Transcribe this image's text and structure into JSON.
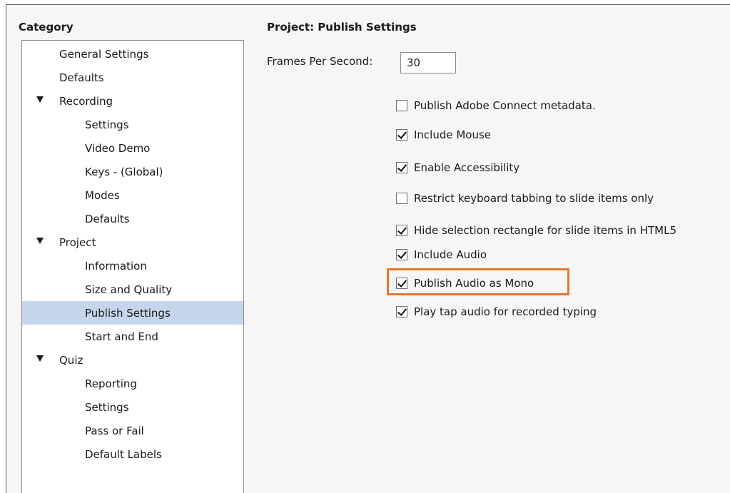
{
  "category": {
    "header": "Category",
    "items": [
      {
        "label": "General Settings"
      },
      {
        "label": "Defaults"
      },
      {
        "label": "Recording",
        "expanded": true
      },
      {
        "label": "Settings"
      },
      {
        "label": "Video Demo"
      },
      {
        "label": "Keys - (Global)"
      },
      {
        "label": "Modes"
      },
      {
        "label": "Defaults"
      },
      {
        "label": "Project",
        "expanded": true
      },
      {
        "label": "Information"
      },
      {
        "label": "Size and Quality"
      },
      {
        "label": "Publish Settings",
        "selected": true
      },
      {
        "label": "Start and End"
      },
      {
        "label": "Quiz",
        "expanded": true
      },
      {
        "label": "Reporting"
      },
      {
        "label": "Settings"
      },
      {
        "label": "Pass or Fail"
      },
      {
        "label": "Default Labels"
      }
    ]
  },
  "main": {
    "title": "Project: Publish Settings",
    "fps_label": "Frames Per Second:",
    "fps_value": "30",
    "options": [
      {
        "label": "Publish Adobe Connect metadata.",
        "checked": false
      },
      {
        "label": "Include Mouse",
        "checked": true
      },
      {
        "label": "Enable Accessibility",
        "checked": true
      },
      {
        "label": "Restrict keyboard tabbing to slide items only",
        "checked": false
      },
      {
        "label": "Hide selection rectangle for slide items in HTML5",
        "checked": true
      },
      {
        "label": "Include Audio",
        "checked": true
      },
      {
        "label": "Publish Audio as Mono",
        "checked": true
      },
      {
        "label": "Play tap audio for recorded typing",
        "checked": true
      }
    ]
  },
  "colors": {
    "selection": "#c5d5ec",
    "highlight": "#e2762d"
  }
}
